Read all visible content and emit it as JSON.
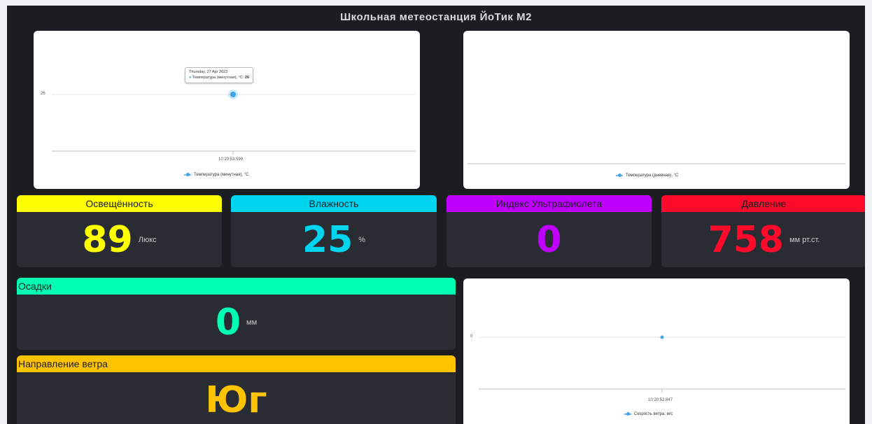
{
  "title": "Школьная метеостанция ЙоТик М2",
  "colors": {
    "background": "#1b1d21",
    "tile": "#2a2c33",
    "yellow": "#ffff00",
    "cyan": "#00d5f0",
    "purple": "#c000ff",
    "red": "#ff0a2b",
    "mint": "#00ffb5",
    "amber": "#ffc300",
    "series": "#3fa6e6"
  },
  "chart_minute": {
    "y_tick": "26",
    "x_tick": "10:20:53.599",
    "tooltip_date": "Thursday, 27 Apr 2023",
    "tooltip_series": "Температура (минутная), °C:",
    "tooltip_value": "26",
    "legend": "Температура (минутная), °C"
  },
  "chart_daily": {
    "legend": "Температура (дневная), °C"
  },
  "chart_wind": {
    "y_tick": "0",
    "x_tick": "10:20:52.847",
    "legend": "Скорость ветра, м/с"
  },
  "chart_data": [
    {
      "type": "line",
      "series": [
        {
          "name": "Температура (минутная), °C",
          "x": [
            "10:20:53.599"
          ],
          "values": [
            26
          ]
        }
      ]
    },
    {
      "type": "line",
      "series": [
        {
          "name": "Температура (дневная), °C",
          "x": [],
          "values": []
        }
      ]
    },
    {
      "type": "line",
      "series": [
        {
          "name": "Скорость ветра, м/с",
          "x": [
            "10:20:52.847"
          ],
          "values": [
            0
          ]
        }
      ]
    }
  ],
  "tiles": {
    "light": {
      "label": "Освещённость",
      "value": "89",
      "unit": "Люкс"
    },
    "humidity": {
      "label": "Влажность",
      "value": "25",
      "unit": "%"
    },
    "uv": {
      "label": "Индекс Ультрафиолета",
      "value": "0"
    },
    "pressure": {
      "label": "Давление",
      "value": "758",
      "unit": "мм рт.ст."
    },
    "precip": {
      "label": "Осадки",
      "value": "0",
      "unit": "мм"
    },
    "wind_dir": {
      "label": "Направление ветра",
      "value": "Юг"
    }
  }
}
